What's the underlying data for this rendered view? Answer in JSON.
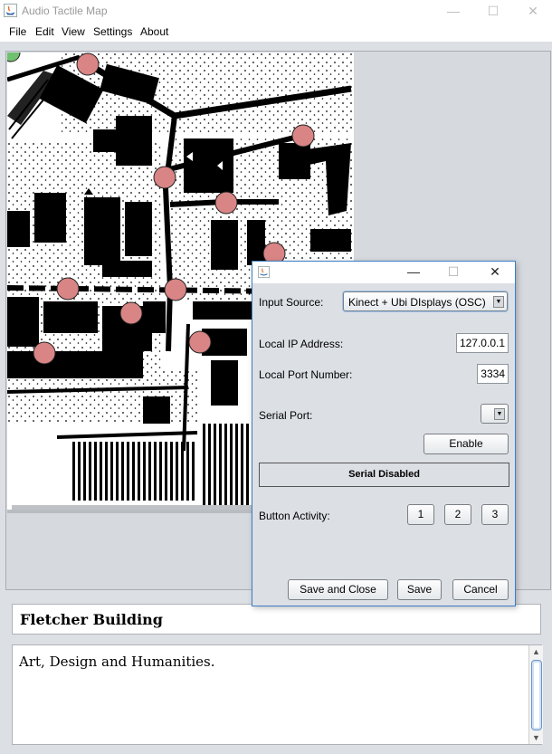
{
  "window": {
    "title": "Audio Tactile Map",
    "controls": {
      "minimize": "—",
      "maximize": "☐",
      "close": "✕"
    }
  },
  "menu": [
    "File",
    "Edit",
    "View",
    "Settings",
    "About"
  ],
  "map": {
    "marker_color": "#d98585",
    "icon": "campus-map"
  },
  "location": {
    "name": "Fletcher Building",
    "description": "Art, Design and Humanities."
  },
  "dialog": {
    "controls": {
      "minimize": "—",
      "maximize": "☐",
      "close": "✕"
    },
    "input_source_label": "Input Source:",
    "input_source_value": "Kinect + Ubi DIsplays (OSC)",
    "local_ip_label": "Local IP Address:",
    "local_ip_value": "127.0.0.1",
    "local_port_label": "Local Port Number:",
    "local_port_value": "3334",
    "serial_port_label": "Serial Port:",
    "serial_port_value": "",
    "enable_button": "Enable",
    "serial_status": "Serial Disabled",
    "button_activity_label": "Button Activity:",
    "activity_buttons": [
      "1",
      "2",
      "3"
    ],
    "save_close_button": "Save and Close",
    "save_button": "Save",
    "cancel_button": "Cancel"
  }
}
